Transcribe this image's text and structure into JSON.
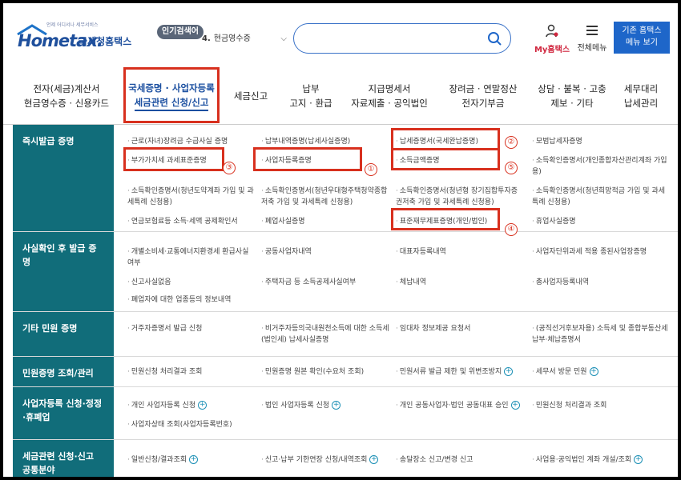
{
  "header": {
    "logo_tag": "언제 어디서나 세무서비스",
    "logo_word": "Hometax.",
    "logo_kor": "국세청홈택스",
    "popular_badge": "인기검색어",
    "popular_rank": "4.",
    "popular_term": "현금영수증",
    "search_placeholder": "",
    "my_hometax": "My홈택스",
    "all_menu": "전체메뉴",
    "old_menu_line1": "기존 홈택스",
    "old_menu_line2": "메뉴 보기"
  },
  "nav": [
    {
      "l1": "전자(세금)계산서",
      "l2": "현금영수증 · 신용카드"
    },
    {
      "l1": "국세증명 · 사업자등록",
      "l2": "세금관련 신청/신고"
    },
    {
      "l1": "세금신고",
      "l2": ""
    },
    {
      "l1": "납부",
      "l2": "고지 · 환급"
    },
    {
      "l1": "지급명세서",
      "l2": "자료제출 · 공익법인"
    },
    {
      "l1": "장려금 · 연말정산",
      "l2": "전자기부금"
    },
    {
      "l1": "상담 · 불복 · 고충",
      "l2": "제보 · 기타"
    },
    {
      "l1": "세무대리",
      "l2": "납세관리"
    }
  ],
  "sections": [
    {
      "title": "즉시발급 증명",
      "items": [
        "근로(자녀)장려금 수급사실 증명",
        "납부내역증명(납세사실증명)",
        "납세증명서(국세완납증명)",
        "모범납세자증명",
        "부가가치세 과세표준증명",
        "사업자등록증명",
        "소득금액증명",
        "소득확인증명서(개인종합자산관리계좌 가입용)",
        "소득확인증명서(청년도약계좌 가입 및 과세특례 신청용)",
        "소득확인증명서(청년우대형주택청약종합저축 가입 및 과세특례 신청용)",
        "소득확인증명서(청년형 장기집합투자증권저축 가입 및 과세특례 신청용)",
        "소득확인증명서(청년희망적금 가입 및 과세특례 신청용)",
        "연금보험료등 소득·세액 공제확인서",
        "폐업사실증명",
        "표준재무제표증명(개인/법인)",
        "휴업사실증명"
      ]
    },
    {
      "title": "사실확인 후 발급 증명",
      "items": [
        "개별소비세·교통에너지환경세 환급사실 여부",
        "공동사업자내역",
        "대표자등록내역",
        "사업자단위과세 적용 종된사업장증명",
        "신고사실없음",
        "주택자금 등 소득공제사실여부",
        "체납내역",
        "총사업자등록내역",
        "폐업자에 대한 업종등의 정보내역"
      ]
    },
    {
      "title": "기타 민원 증명",
      "items": [
        "거주자증명서 발급 신청",
        "비거주자등의국내원천소득에 대한 소득세(법인세) 납세사실증명",
        "임대차 정보제공 요청서",
        "(공직선거후보자용) 소득세 및 종합부동산세 납부·체납증명서"
      ]
    },
    {
      "title": "민원증명 조회/관리",
      "items": [
        "민원신청 처리결과 조회",
        "민원증명 원본 확인(수요처 조회)",
        "민원서류 발급 제한 및 위변조방지",
        "세무서 방문 민원"
      ]
    },
    {
      "title": "사업자등록 신청·정정·휴폐업",
      "items": [
        "개인 사업자등록 신청",
        "법인 사업자등록 신청",
        "개인 공동사업자·법인 공동대표 승인",
        "민원신청 처리결과 조회",
        "사업자상태 조회(사업자등록번호)"
      ]
    },
    {
      "title": "세금관련 신청·신고 공통분야",
      "items": [
        "일반신청/결과조회",
        "신고·납부 기한연장 신청/내역조회",
        "송달장소 신고/변경 신고",
        "사업용·공익법인 계좌 개설/조회"
      ]
    }
  ],
  "annotations": [
    "①",
    "②",
    "③",
    "④",
    "⑤"
  ],
  "colors": {
    "accent": "#116d7a",
    "brand": "#1e4f9c",
    "highlight": "#d8301e"
  }
}
